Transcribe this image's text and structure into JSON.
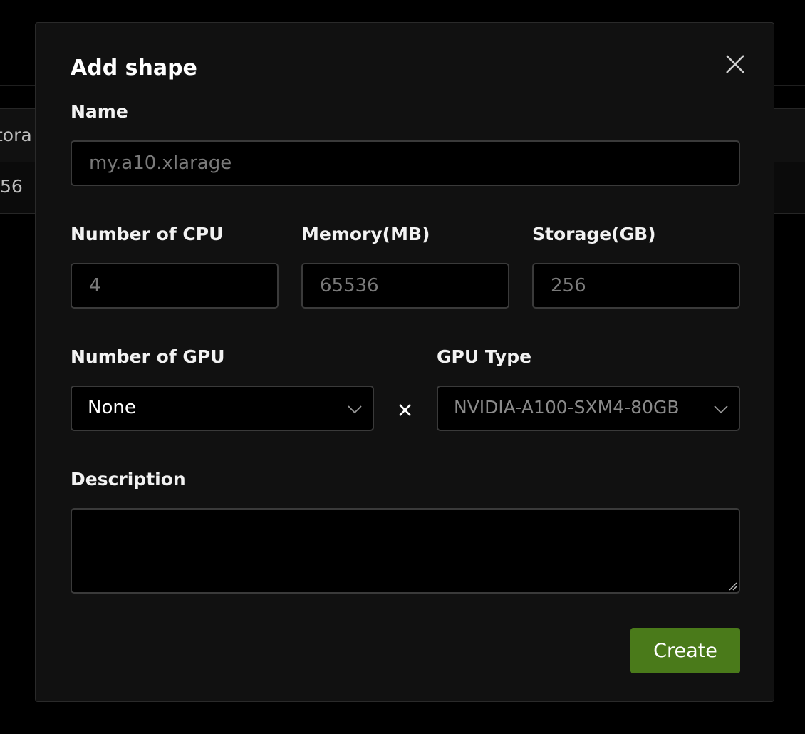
{
  "background": {
    "header_partial": "tora",
    "row_partial": "56"
  },
  "dialog": {
    "title": "Add shape",
    "name": {
      "label": "Name",
      "placeholder": "my.a10.xlarage"
    },
    "cpu": {
      "label": "Number of CPU",
      "placeholder": "4"
    },
    "memory": {
      "label": "Memory(MB)",
      "placeholder": "65536"
    },
    "storage": {
      "label": "Storage(GB)",
      "placeholder": "256"
    },
    "gpu_count": {
      "label": "Number of GPU",
      "value": "None"
    },
    "multiply_symbol": "×",
    "gpu_type": {
      "label": "GPU Type",
      "value": "NVIDIA-A100-SXM4-80GB"
    },
    "description": {
      "label": "Description"
    },
    "create_label": "Create"
  },
  "icons": {
    "close": "close-icon",
    "chevron": "chevron-down-icon"
  },
  "colors": {
    "accent": "#4a7a1a",
    "surface": "#111111"
  }
}
